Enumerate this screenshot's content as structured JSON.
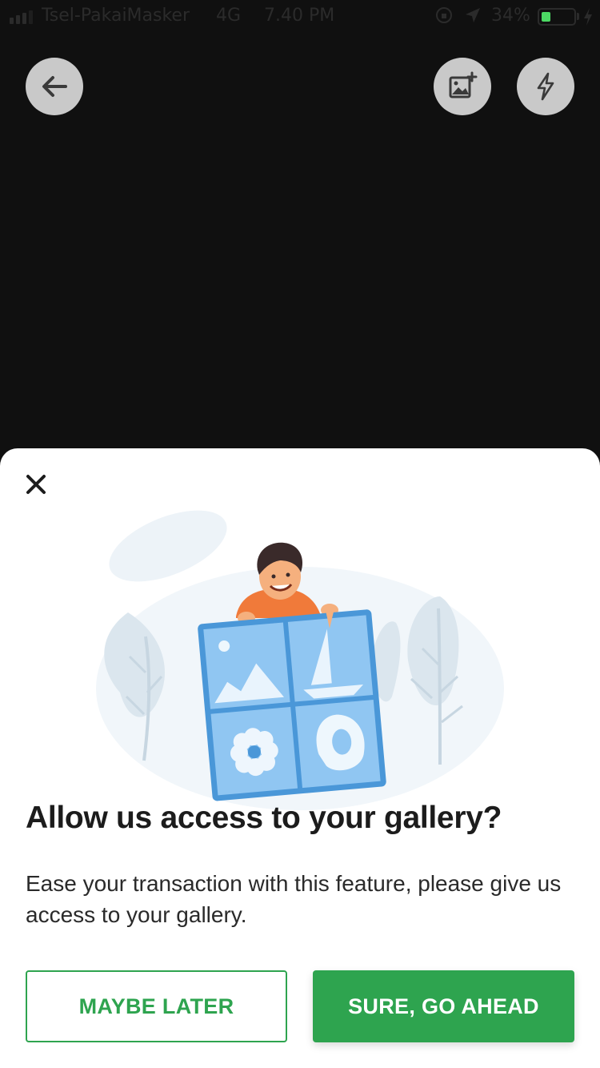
{
  "status_bar": {
    "carrier": "Tsel-PakaiMasker",
    "network": "4G",
    "time": "7.40 PM",
    "battery": "34%",
    "battery_color": "#4cd964"
  },
  "camera_controls": {
    "back_icon": "arrow-left-icon",
    "gallery_icon": "add-photo-icon",
    "flash_icon": "flash-off-icon"
  },
  "dialog": {
    "close_icon": "close-icon",
    "illustration": "gallery-permission-illustration",
    "title": "Allow us access to your gallery?",
    "description": "Ease your transaction with this feature, please give us access to your gallery.",
    "secondary_button": "MAYBE LATER",
    "primary_button": "SURE, GO AHEAD",
    "accent_color": "#2ea44f"
  }
}
